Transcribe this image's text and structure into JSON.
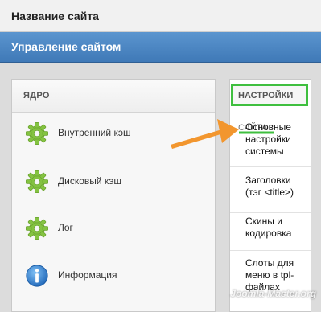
{
  "site": {
    "title": "Название сайта"
  },
  "admin": {
    "title": "Управление сайтом"
  },
  "core": {
    "title": "ЯДРО",
    "items": [
      {
        "label": "Внутренний кэш",
        "icon": "gear-icon"
      },
      {
        "label": "Дисковый кэш",
        "icon": "gear-icon"
      },
      {
        "label": "Лог",
        "icon": "gear-icon"
      },
      {
        "label": "Информация",
        "icon": "info-icon"
      }
    ]
  },
  "settings": {
    "title": "НАСТРОЙКИ",
    "subtitle": "САЙТА",
    "links": [
      "Основные настройки системы",
      "Заголовки (тэг <title>)",
      "Скины и кодировка",
      "Слоты для меню в tpl-файлах"
    ]
  },
  "colors": {
    "topbar": "#f1f1f1",
    "adminbar": "#4a86c4",
    "highlight": "#3fbf3f",
    "arrow": "#f2962e",
    "gear": "#84c341",
    "info": "#2f7fd0"
  },
  "watermark": "Joomla-Master.org"
}
